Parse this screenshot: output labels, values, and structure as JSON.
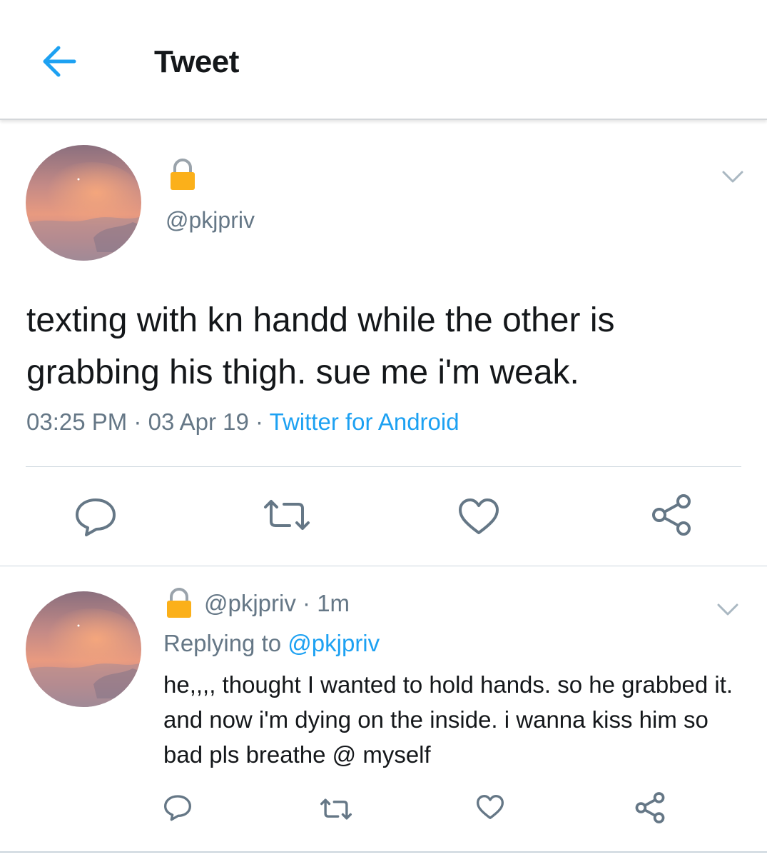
{
  "header": {
    "title": "Tweet",
    "back_icon": "arrow-left-icon"
  },
  "colors": {
    "accent": "#1da1f2",
    "secondary_text": "#657786",
    "lock": "#fbb01a"
  },
  "main_tweet": {
    "handle": "@pkjpriv",
    "protected_icon": "lock-icon",
    "text": "texting with kn handd while the other is grabbing his thigh. sue me i'm weak.",
    "time": "03:25 PM",
    "date": "03 Apr 19",
    "separator": "·",
    "source": "Twitter for Android",
    "actions": [
      "reply-icon",
      "retweet-icon",
      "like-icon",
      "share-icon"
    ]
  },
  "reply_tweet": {
    "handle": "@pkjpriv",
    "time_ago": "1m",
    "separator": "·",
    "replying_label": "Replying to",
    "replying_to": "@pkjpriv",
    "text": "he,,,, thought I wanted to hold hands. so he grabbed it. and now i'm dying on the inside. i wanna kiss him so bad pls breathe @ myself",
    "actions": [
      "reply-icon",
      "retweet-icon",
      "like-icon",
      "share-icon"
    ]
  }
}
